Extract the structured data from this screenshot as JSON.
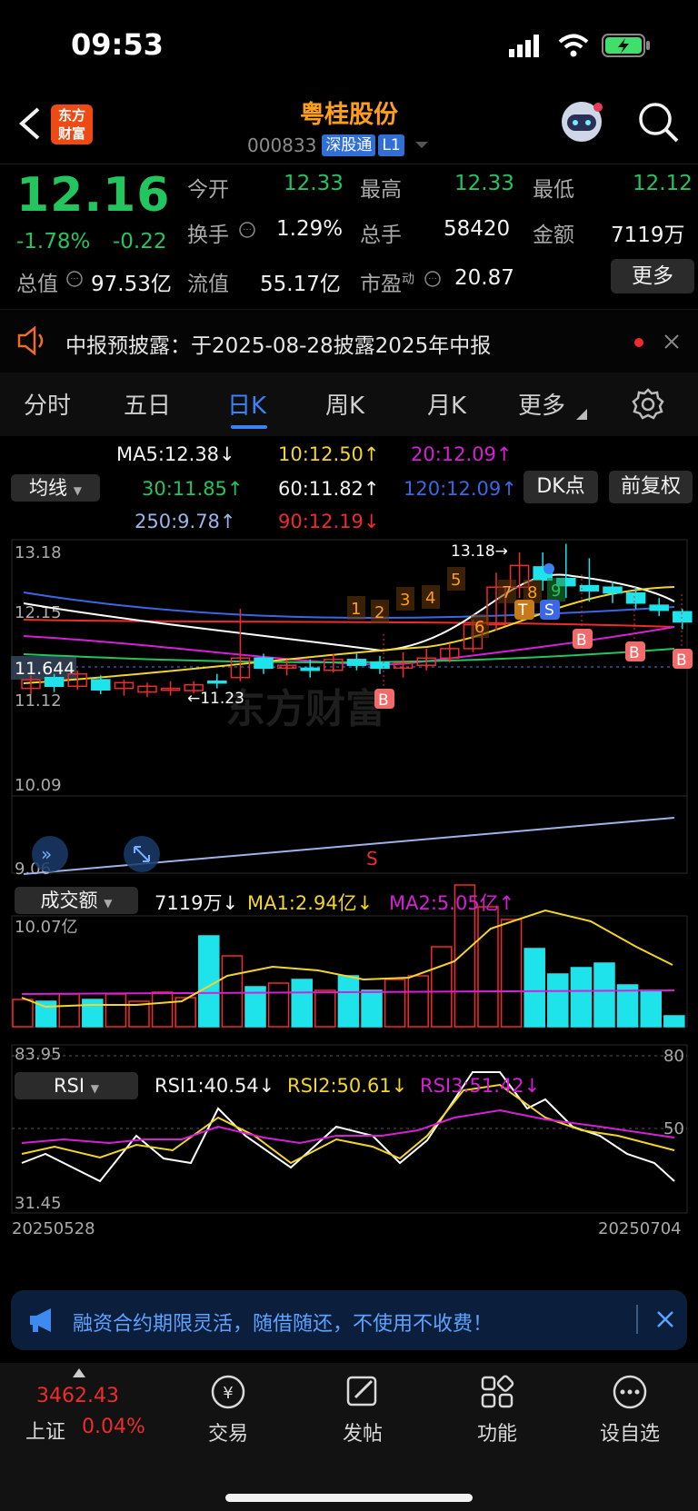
{
  "status": {
    "time": "09:53"
  },
  "header": {
    "logo": "东方财富",
    "name": "粤桂股份",
    "code": "000833",
    "tag1": "深股通",
    "tag2": "L1"
  },
  "quote": {
    "price": "12.16",
    "pct": "-1.78%",
    "chg": "-0.22",
    "open_label": "今开",
    "open": "12.33",
    "high_label": "最高",
    "high": "12.33",
    "low_label": "最低",
    "low": "12.12",
    "turnover_label": "换手",
    "turnover": "1.29%",
    "volume_label": "总手",
    "volume": "58420",
    "amount_label": "金额",
    "amount": "7119万",
    "mktcap_label": "总值",
    "mktcap": "97.53亿",
    "float_label": "流值",
    "float": "55.17亿",
    "pe_label": "市盈",
    "pe_sup": "动",
    "pe": "20.87",
    "more": "更多"
  },
  "notice": {
    "text": "中报预披露：于2025-08-28披露2025年中报"
  },
  "tabs": [
    "分时",
    "五日",
    "日K",
    "周K",
    "月K",
    "更多"
  ],
  "ma": {
    "selector": "均线",
    "ma5": "MA5:12.38↓",
    "ma10": "10:12.50↑",
    "ma20": "20:12.09↑",
    "ma30": "30:11.85↑",
    "ma60": "60:11.82↑",
    "ma120": "120:12.09↑",
    "ma250": "250:9.78↑",
    "ma90": "90:12.19↓",
    "dk": "DK点",
    "fq": "前复权"
  },
  "kline": {
    "y_labels": [
      "13.18",
      "12.15",
      "11.12",
      "10.09",
      "9.06"
    ],
    "current": "11.644",
    "high_note": "13.18→",
    "low_note": "←11.23",
    "markers": [
      "1",
      "2",
      "3",
      "4",
      "5",
      "6",
      "7",
      "8",
      "9"
    ],
    "b": "B",
    "s": "S",
    "t": "T",
    "watermark": "东方财富"
  },
  "volume": {
    "selector": "成交额",
    "v": "7119万↓",
    "ma1": "MA1:2.94亿↓",
    "ma2": "MA2:5.05亿↑",
    "top": "10.07亿"
  },
  "rsi": {
    "selector": "RSI",
    "r1": "RSI1:40.54↓",
    "r2": "RSI2:50.61↓",
    "r3": "RSI3:51.42↓",
    "top": "83.95",
    "bottom": "31.45",
    "r80": "80",
    "r50": "50",
    "date_start": "20250528",
    "date_end": "20250704"
  },
  "banner": {
    "text": "融资合约期限灵活，随借随还，不使用不收费！"
  },
  "footer": {
    "index_value": "3462.43",
    "index_name": "上证",
    "index_pct": "0.04%",
    "items": [
      "交易",
      "发帖",
      "功能",
      "设自选"
    ]
  },
  "colors": {
    "up": "#ef2b2b",
    "down": "#22c55e",
    "cyan": "#1fe3ea",
    "accent": "#3b82f6",
    "brand": "#ff9e1a"
  }
}
